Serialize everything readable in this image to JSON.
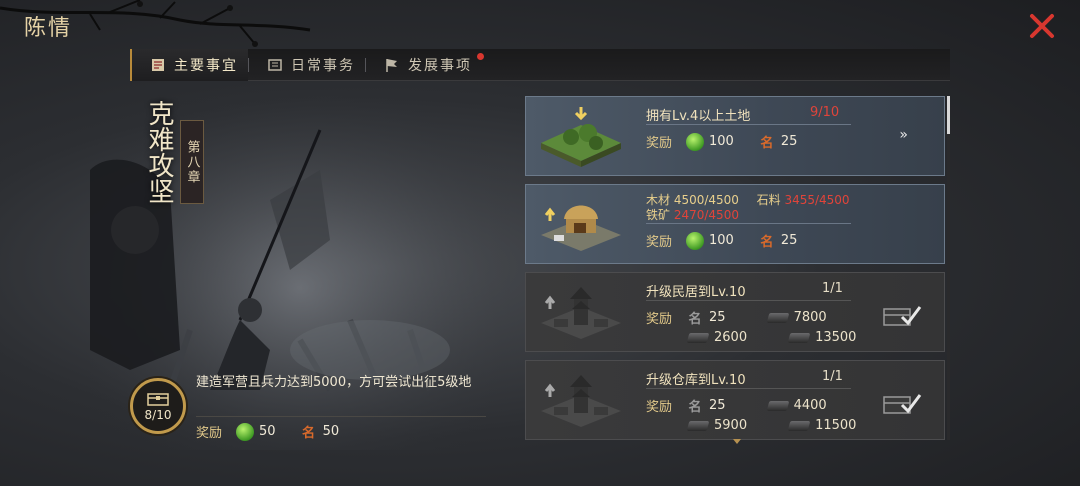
{
  "window": {
    "title": "陈情"
  },
  "tabs": [
    {
      "label": "主要事宜",
      "active": true
    },
    {
      "label": "日常事务",
      "active": false
    },
    {
      "label": "发展事项",
      "active": false,
      "notification": true
    }
  ],
  "chapter": {
    "title": "克难攻坚",
    "tag": "第八章"
  },
  "main_task": {
    "progress_text": "8/10",
    "description": "建造军营且兵力达到5000，方可尝试出征5级地",
    "reward_label": "奖励",
    "reward_jade": "50",
    "reward_ming": "50"
  },
  "reward_icons": {
    "ming_glyph": "名"
  },
  "tasks": [
    {
      "title": "拥有Lv.4以上土地",
      "progress": "9/10",
      "reward_label": "奖励",
      "jade": "100",
      "ming": "25",
      "action": "»"
    },
    {
      "wood_label": "木材 4500/4500",
      "stone_label": "石料",
      "stone_value": "3455/4500",
      "iron_label": "铁矿",
      "iron_value": "2470/4500",
      "reward_label": "奖励",
      "jade": "100",
      "ming": "25"
    },
    {
      "title": "升级民居到Lv.10",
      "progress": "1/1",
      "reward_label": "奖励",
      "ming": "25",
      "res1": "7800",
      "res2": "2600",
      "res3": "13500"
    },
    {
      "title": "升级仓库到Lv.10",
      "progress": "1/1",
      "reward_label": "奖励",
      "ming": "25",
      "res1": "4400",
      "res2": "5900",
      "res3": "11500"
    }
  ],
  "colors": {
    "accent_gold": "#c19a4c",
    "progress_red": "#e0443a",
    "close_red": "#d8372f"
  }
}
